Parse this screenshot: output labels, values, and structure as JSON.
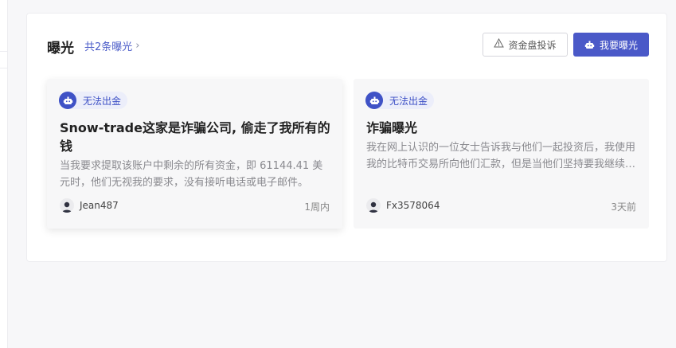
{
  "exposure": {
    "title": "曝光",
    "total_link": "共2条曝光",
    "complaint_button": "资金盘投诉",
    "expose_button": "我要曝光"
  },
  "cards": [
    {
      "tag": "无法出金",
      "title": "Snow-trade这家是诈骗公司, 偷走了我所有的钱",
      "desc": "当我要求提取该账户中剩余的所有资金，即 61144.41 美元时，他们无视我的要求，没有接听电话或电子邮件。",
      "author": "Jean487",
      "time": "1周内"
    },
    {
      "tag": "无法出金",
      "title": "诈骗曝光",
      "desc": "我在网上认识的一位女士告诉我与他们一起投资后，我使用我的比特币交易所向他们汇款，但是当他们坚持要我继续存钱时，我意识到这是骗局。",
      "author": "Fx3578064",
      "time": "3天前"
    }
  ],
  "colors": {
    "accent": "#4a59c8",
    "tag_bg": "#eceefa"
  }
}
